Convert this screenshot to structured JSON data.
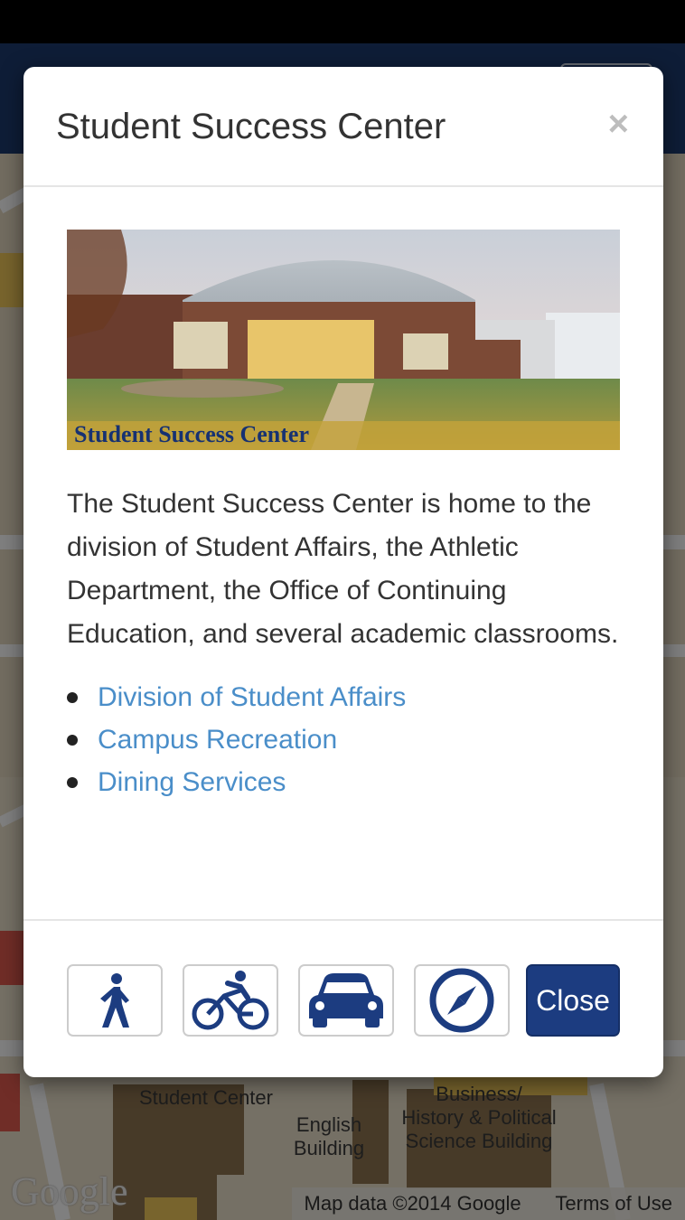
{
  "modal": {
    "title": "Student Success Center",
    "close_glyph": "×",
    "image": {
      "caption": "Student Success Center"
    },
    "description": "The Student Success Center is home to the division of Student Affairs, the Athletic Department, the Office of Continuing Education, and several academic classrooms.",
    "links": [
      {
        "label": "Division of Student Affairs"
      },
      {
        "label": "Campus Recreation"
      },
      {
        "label": "Dining Services"
      }
    ],
    "footer": {
      "buttons": [
        {
          "icon": "walking-icon"
        },
        {
          "icon": "bicycle-icon"
        },
        {
          "icon": "car-icon"
        },
        {
          "icon": "compass-icon"
        }
      ],
      "close_label": "Close"
    }
  },
  "map": {
    "labels": {
      "student_center": "Student Center",
      "english_building": "English\nBuilding",
      "business_building": "Business/\nHistory & Political\nScience Building"
    },
    "logo": "Google",
    "attribution": "Map data ©2014 Google",
    "terms": "Terms of Use"
  },
  "colors": {
    "header": "#1c3a6e",
    "link": "#4a8ec9",
    "primary_button": "#1c3c80",
    "icon": "#1c3c80"
  }
}
